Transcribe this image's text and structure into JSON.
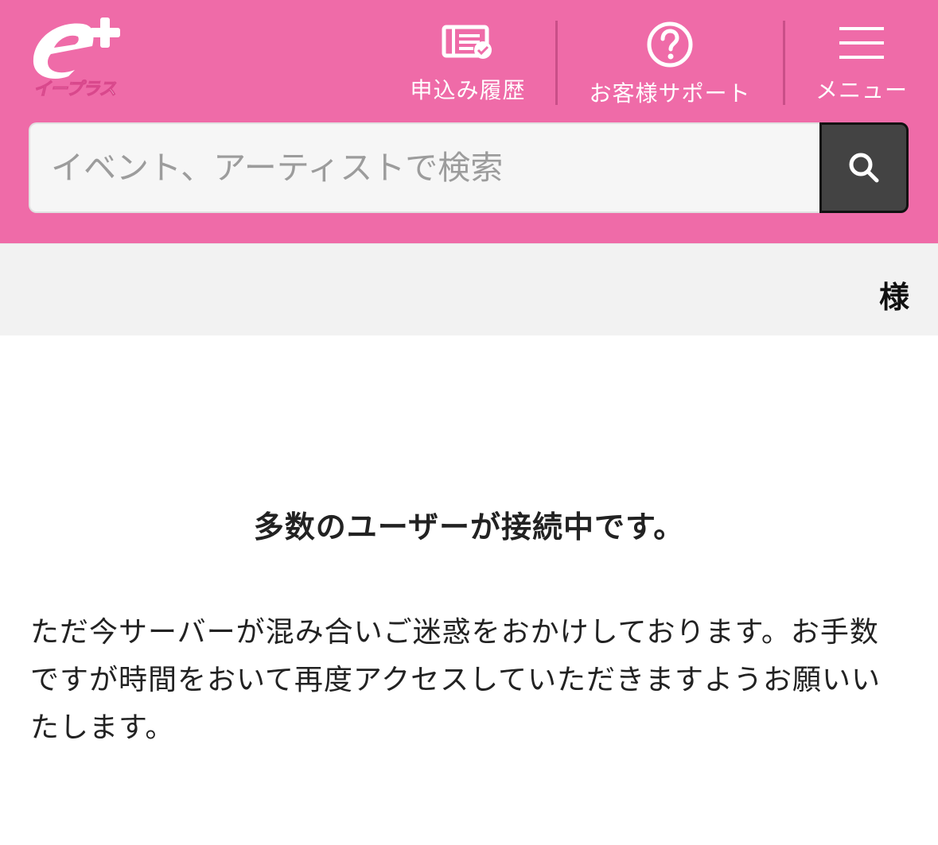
{
  "brand": {
    "logo_text": "イープラス",
    "color": "#ef6ba8"
  },
  "header": {
    "nav": [
      {
        "label": "申込み履歴",
        "icon": "history-ticket-icon"
      },
      {
        "label": "お客様サポート",
        "icon": "help-circle-icon"
      },
      {
        "label": "メニュー",
        "icon": "hamburger-menu-icon"
      }
    ]
  },
  "search": {
    "placeholder": "イベント、アーティストで検索",
    "icon": "search-icon"
  },
  "user_bar": {
    "honorific": "様"
  },
  "main": {
    "title": "多数のユーザーが接続中です。",
    "message": "ただ今サーバーが混み合いご迷惑をおかけしております。お手数ですが時間をおいて再度アクセスしていただきますようお願いいたします。"
  }
}
